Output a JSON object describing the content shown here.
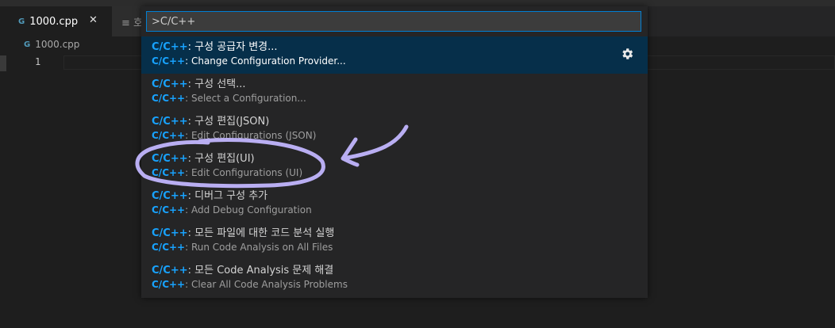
{
  "tabs": {
    "active": {
      "icon": "G",
      "label": "1000.cpp",
      "close": "✕"
    },
    "second": {
      "label": "≡ 호"
    }
  },
  "breadcrumb": {
    "icon": "G",
    "label": "1000.cpp"
  },
  "editor": {
    "line_number": "1"
  },
  "palette": {
    "query": ">C/C++",
    "items": [
      {
        "prefix": "C/C++",
        "label": ": 구성 공급자 변경...",
        "sub_prefix": "C/C++",
        "sub_label": ": Change Configuration Provider...",
        "selected": true
      },
      {
        "prefix": "C/C++",
        "label": ": 구성 선택...",
        "sub_prefix": "C/C++",
        "sub_label": ": Select a Configuration..."
      },
      {
        "prefix": "C/C++",
        "label": ": 구성 편집(JSON)",
        "sub_prefix": "C/C++",
        "sub_label": ": Edit Configurations (JSON)"
      },
      {
        "prefix": "C/C++",
        "label": ": 구성 편집(UI)",
        "sub_prefix": "C/C++",
        "sub_label": ": Edit Configurations (UI)"
      },
      {
        "prefix": "C/C++",
        "label": ": 디버그 구성 추가",
        "sub_prefix": "C/C++",
        "sub_label": ": Add Debug Configuration"
      },
      {
        "prefix": "C/C++",
        "label": ": 모든 파일에 대한 코드 분석 실행",
        "sub_prefix": "C/C++",
        "sub_label": ": Run Code Analysis on All Files"
      },
      {
        "prefix": "C/C++",
        "label": ": 모든 Code Analysis 문제 해결",
        "sub_prefix": "C/C++",
        "sub_label": ": Clear All Code Analysis Problems"
      }
    ],
    "gear_icon": "gear-icon"
  },
  "annotation": {
    "color": "#b9aef2",
    "target_item": ": 구성 편집(UI)"
  }
}
